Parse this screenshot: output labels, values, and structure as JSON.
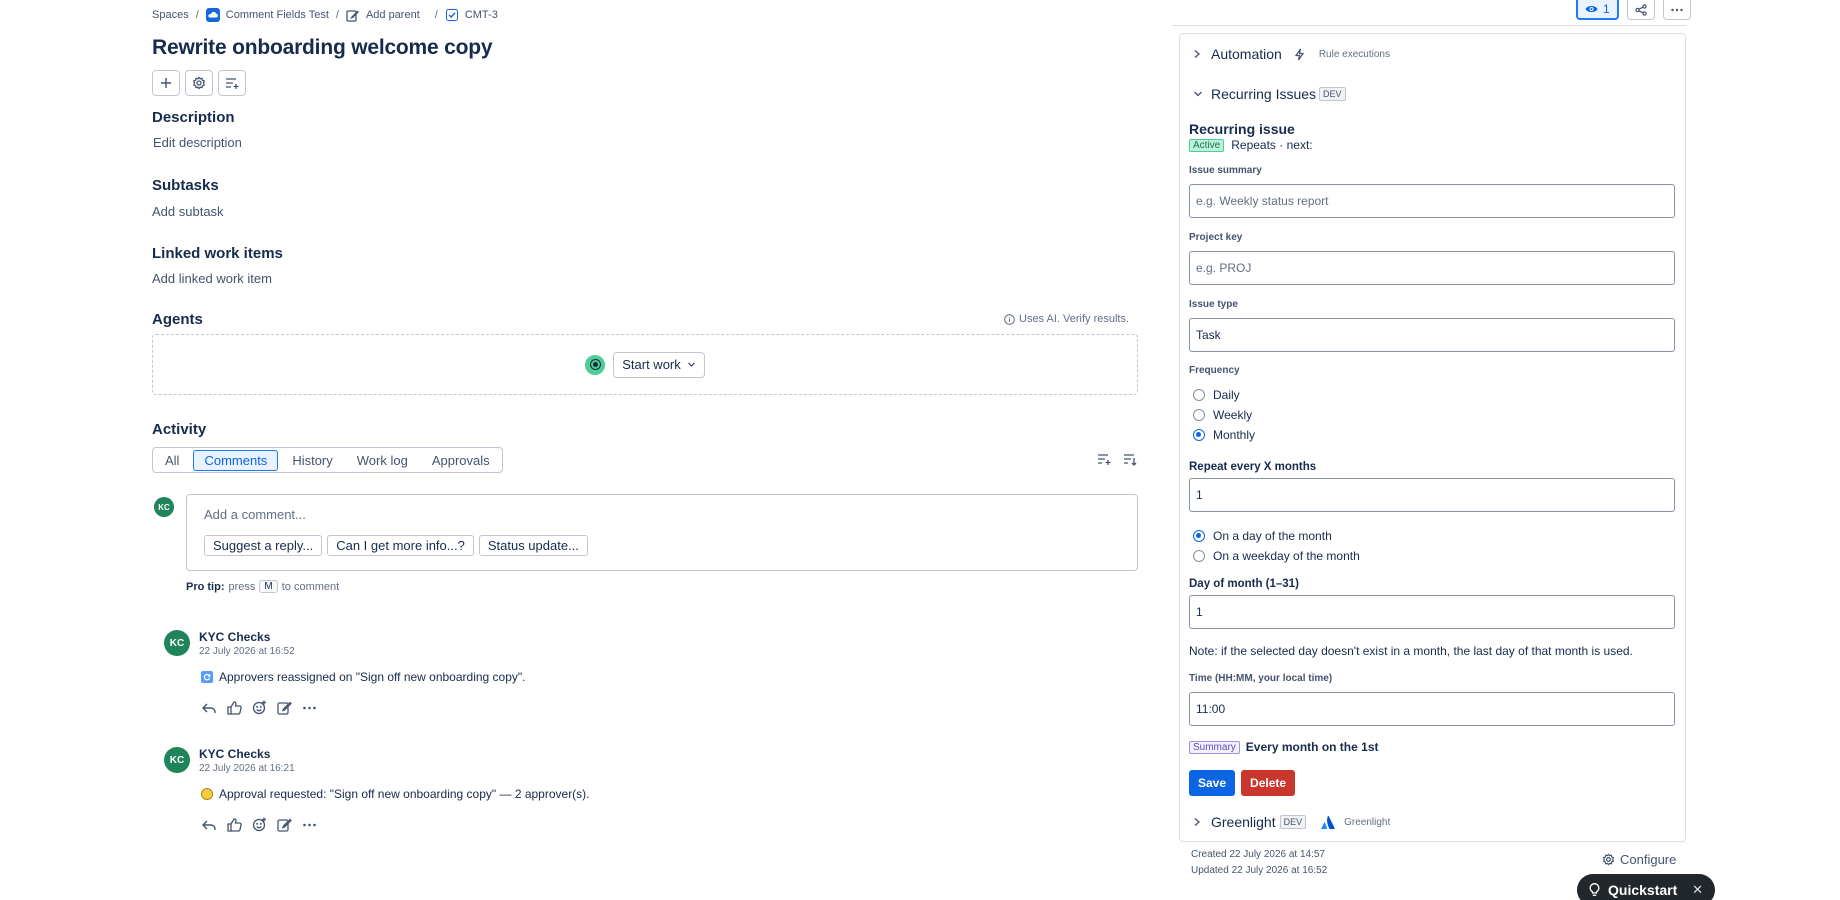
{
  "breadcrumb": {
    "spaces": "Spaces",
    "project": "Comment Fields Test",
    "add_parent": "Add parent",
    "issue_key": "CMT-3"
  },
  "issue": {
    "title": "Rewrite onboarding welcome copy"
  },
  "sections": {
    "description": {
      "heading": "Description",
      "placeholder": "Edit description"
    },
    "subtasks": {
      "heading": "Subtasks",
      "action": "Add subtask"
    },
    "linked": {
      "heading": "Linked work items",
      "action": "Add linked work item"
    },
    "agents": {
      "heading": "Agents",
      "ai_note": "Uses AI. Verify results.",
      "start_work": "Start work"
    }
  },
  "activity": {
    "heading": "Activity",
    "tabs": [
      "All",
      "Comments",
      "History",
      "Work log",
      "Approvals"
    ],
    "active_tab": "Comments",
    "current_user_initials": "KC",
    "comment_placeholder": "Add a comment...",
    "suggestions": [
      "Suggest a reply...",
      "Can I get more info...?",
      "Status update..."
    ],
    "protip_label": "Pro tip:",
    "protip_press": "press",
    "protip_key": "M",
    "protip_suffix": "to comment",
    "comments": [
      {
        "initials": "KC",
        "author": "KYC Checks",
        "date": "22 July 2026 at 16:52",
        "text": "Approvers reassigned on \"Sign off new onboarding copy\"."
      },
      {
        "initials": "KC",
        "author": "KYC Checks",
        "date": "22 July 2026 at 16:21",
        "text": "Approval requested: \"Sign off new onboarding copy\" — 2 approver(s)."
      }
    ]
  },
  "panel": {
    "watch_count": "1",
    "automation": {
      "label": "Automation",
      "sub": "Rule executions"
    },
    "recurring": {
      "label": "Recurring Issues",
      "badge": "DEV",
      "title": "Recurring issue",
      "status": "Active",
      "status_text": "Repeats · next:",
      "fields": {
        "summary_label": "Issue summary",
        "summary_placeholder": "e.g. Weekly status report",
        "project_label": "Project key",
        "project_placeholder": "e.g. PROJ",
        "type_label": "Issue type",
        "type_value": "Task",
        "frequency_label": "Frequency",
        "frequency_options": [
          "Daily",
          "Weekly",
          "Monthly"
        ],
        "frequency_selected": "Monthly",
        "repeat_label": "Repeat every X months",
        "repeat_value": "1",
        "mode_options": [
          "On a day of the month",
          "On a weekday of the month"
        ],
        "mode_selected": "On a day of the month",
        "day_label": "Day of month (1–31)",
        "day_value": "1",
        "note": "Note: if the selected day doesn't exist in a month, the last day of that month is used.",
        "time_label": "Time (HH:MM, your local time)",
        "time_value": "11:00"
      },
      "summary_badge": "Summary",
      "summary_text": "Every month on the 1st",
      "save": "Save",
      "delete": "Delete"
    },
    "greenlight": {
      "label": "Greenlight",
      "badge": "DEV",
      "sub": "Greenlight"
    },
    "created": "Created 22 July 2026 at 14:57",
    "updated": "Updated 22 July 2026 at 16:52",
    "configure": "Configure",
    "quickstart": "Quickstart"
  }
}
